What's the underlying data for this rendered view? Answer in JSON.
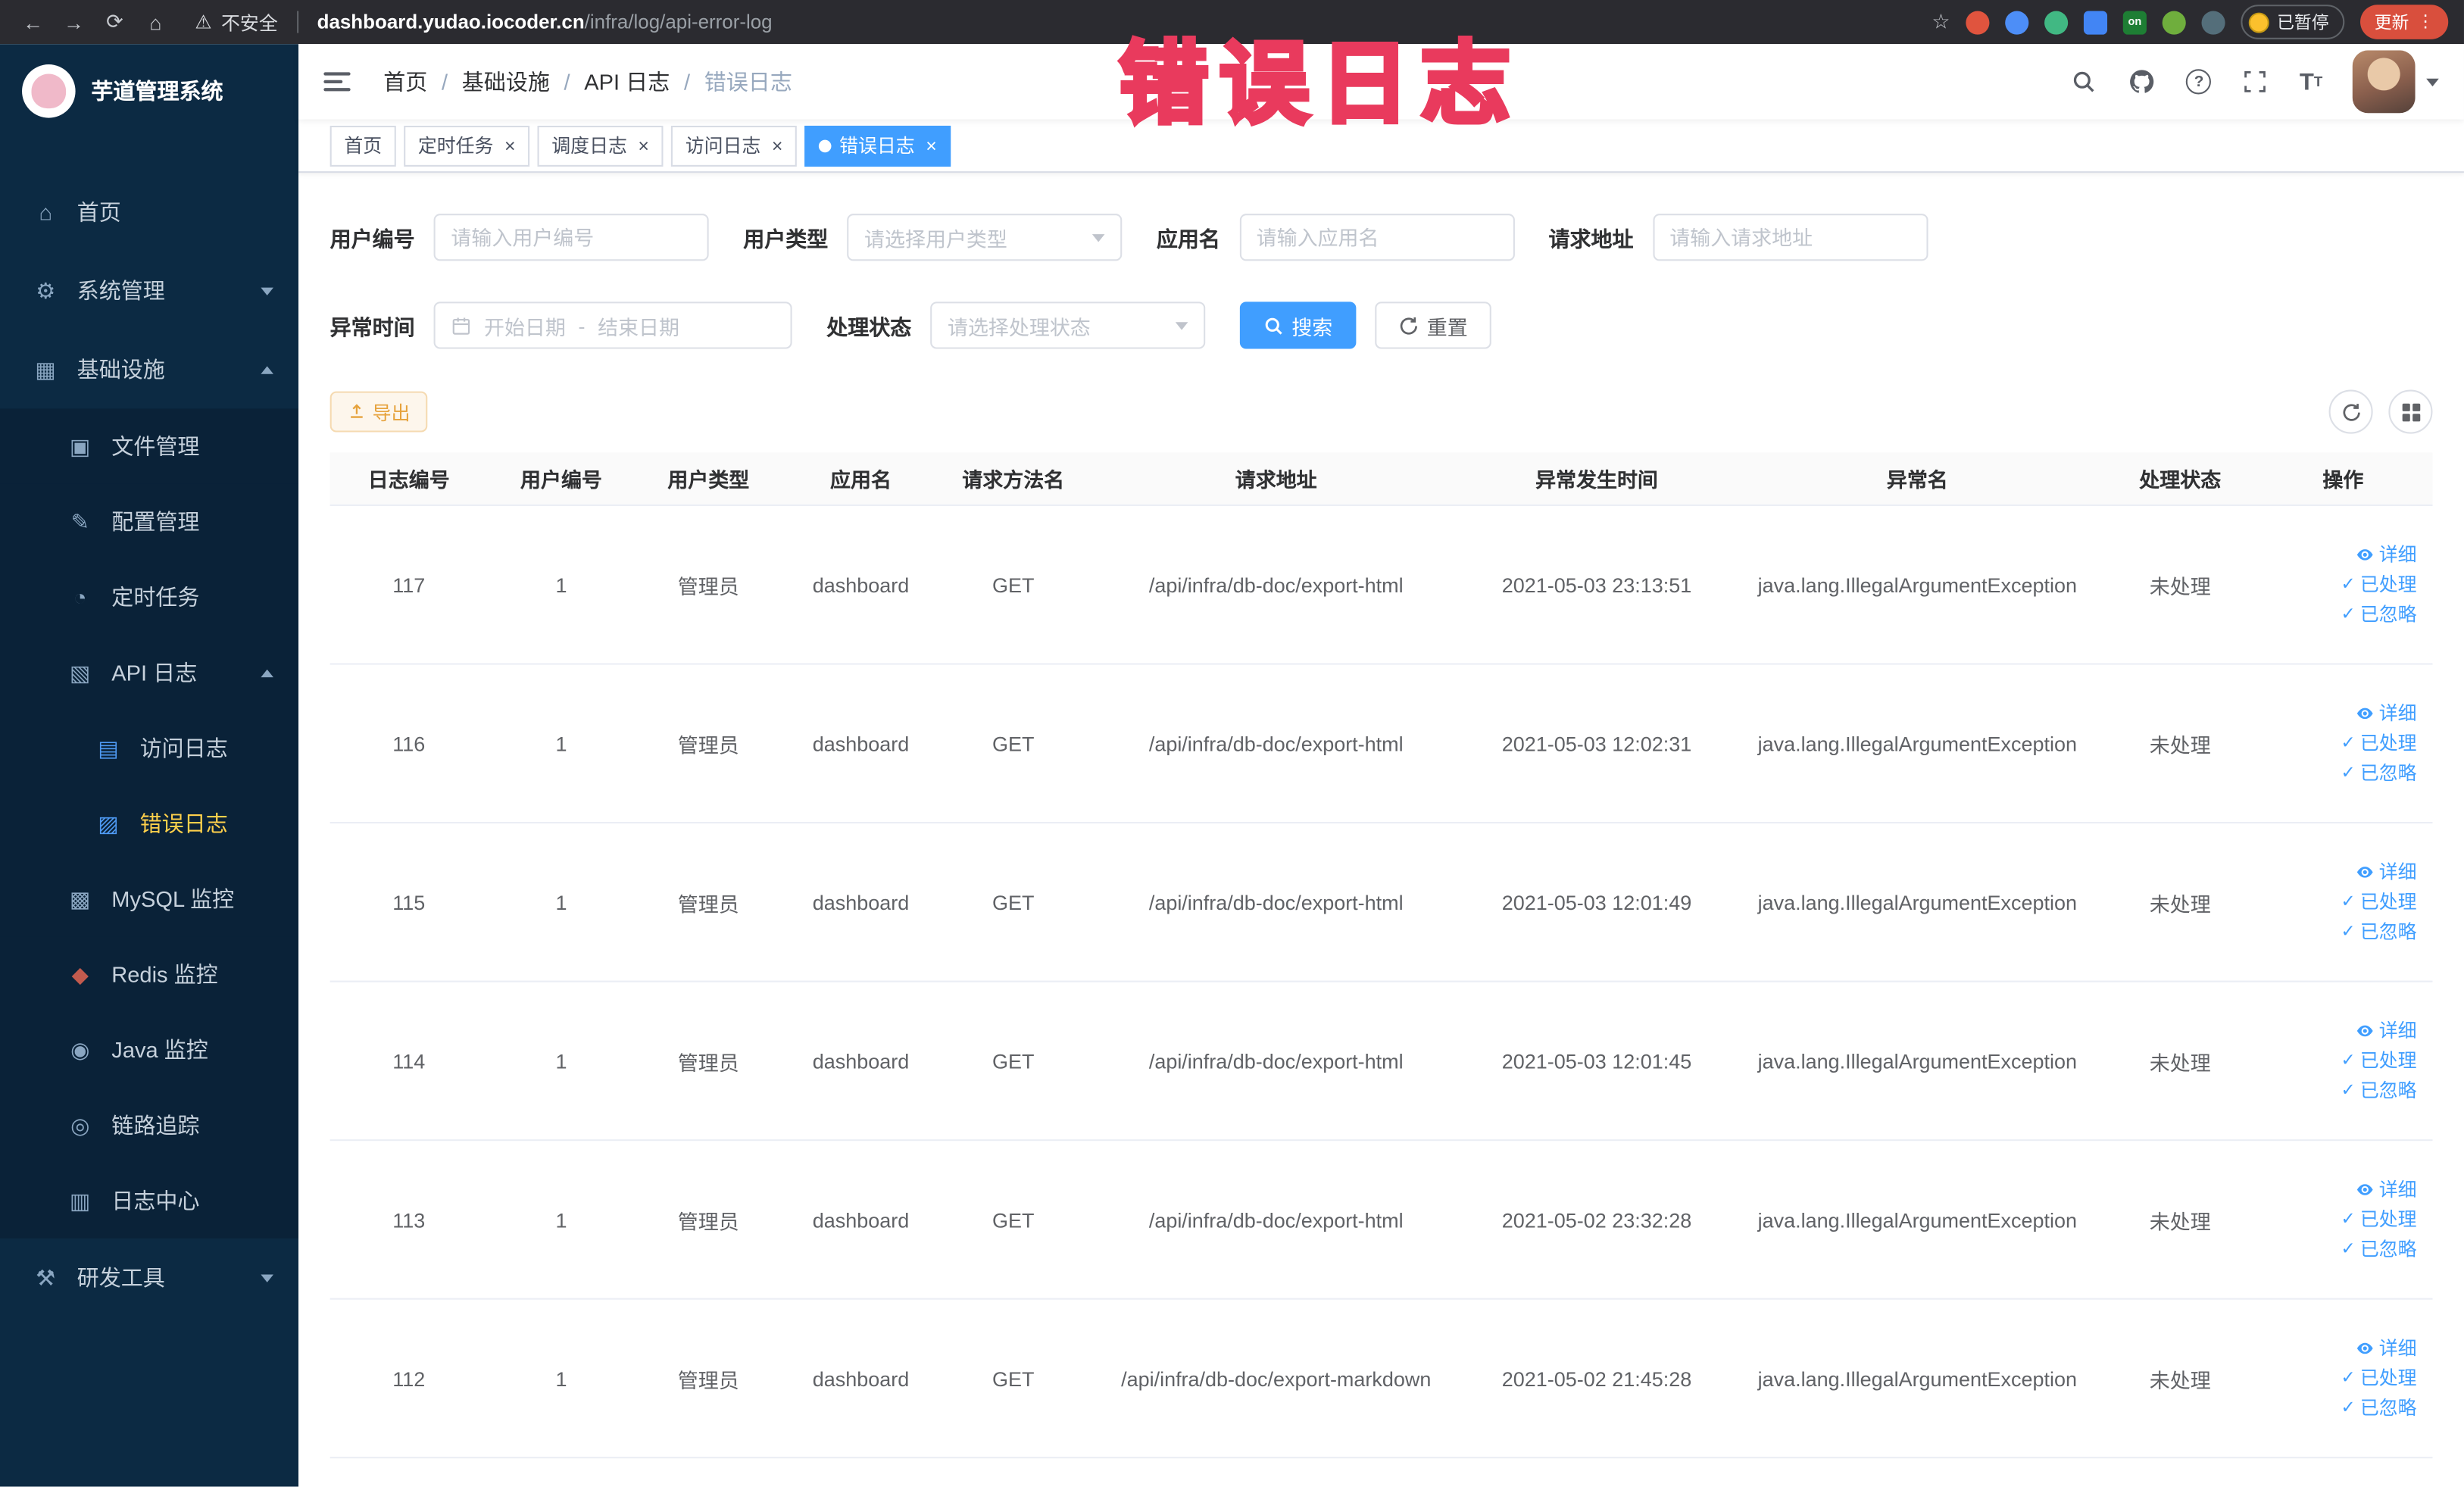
{
  "browser": {
    "security_label": "不安全",
    "url_domain": "dashboard.yudao.iocoder.cn",
    "url_path": "/infra/log/api-error-log",
    "paused_label": "已暂停",
    "update_label": "更新",
    "extensions": [
      {
        "name": "extension-red-circle-icon",
        "color": "#e0543e",
        "shape": "circle"
      },
      {
        "name": "extension-blue-drop-icon",
        "color": "#4d8ef7",
        "shape": "circle"
      },
      {
        "name": "extension-vue-devtools-icon",
        "color": "#41b883",
        "shape": "circle"
      },
      {
        "name": "extension-blue-grid-icon",
        "color": "#4285f4",
        "shape": "square"
      },
      {
        "name": "extension-on-badge-icon",
        "color": "#1e7e34",
        "shape": "square",
        "label": "on"
      },
      {
        "name": "extension-leaf-icon",
        "color": "#6fae3d",
        "shape": "circle"
      },
      {
        "name": "extension-paw-icon",
        "color": "#546e7a",
        "shape": "circle"
      }
    ]
  },
  "annotation": {
    "text": "错误日志"
  },
  "sidebar": {
    "logo_title": "芋道管理系统",
    "items": [
      {
        "label": "首页",
        "icon": "home-icon",
        "level": 1
      },
      {
        "label": "系统管理",
        "icon": "system-icon",
        "level": 1,
        "chevron": "down"
      },
      {
        "label": "基础设施",
        "icon": "infra-icon",
        "level": 1,
        "chevron": "up"
      },
      {
        "label": "文件管理",
        "icon": "file-icon",
        "level": 2
      },
      {
        "label": "配置管理",
        "icon": "config-icon",
        "level": 2
      },
      {
        "label": "定时任务",
        "icon": "job-icon",
        "level": 2
      },
      {
        "label": "API 日志",
        "icon": "api-log-icon",
        "level": 2,
        "chevron": "up"
      },
      {
        "label": "访问日志",
        "icon": "access-log-icon",
        "level": 3,
        "icon_color": "#4f9bf5"
      },
      {
        "label": "错误日志",
        "icon": "error-log-icon",
        "level": 3,
        "icon_color": "#4f9bf5",
        "active": true
      },
      {
        "label": "MySQL 监控",
        "icon": "mysql-icon",
        "level": 2
      },
      {
        "label": "Redis 监控",
        "icon": "redis-icon",
        "level": 2,
        "icon_color": "#c25b4e"
      },
      {
        "label": "Java 监控",
        "icon": "java-icon",
        "level": 2
      },
      {
        "label": "链路追踪",
        "icon": "trace-icon",
        "level": 2
      },
      {
        "label": "日志中心",
        "icon": "log-center-icon",
        "level": 2
      },
      {
        "label": "研发工具",
        "icon": "dev-tools-icon",
        "level": 1,
        "chevron": "down"
      }
    ]
  },
  "header": {
    "breadcrumb": [
      "首页",
      "基础设施",
      "API 日志",
      "错误日志"
    ]
  },
  "tags_view": [
    {
      "label": "首页",
      "closable": false,
      "active": false
    },
    {
      "label": "定时任务",
      "closable": true,
      "active": false
    },
    {
      "label": "调度日志",
      "closable": true,
      "active": false
    },
    {
      "label": "访问日志",
      "closable": true,
      "active": false
    },
    {
      "label": "错误日志",
      "closable": true,
      "active": true
    }
  ],
  "filters": {
    "user_id": {
      "label": "用户编号",
      "placeholder": "请输入用户编号"
    },
    "user_type": {
      "label": "用户类型",
      "placeholder": "请选择用户类型"
    },
    "app_name": {
      "label": "应用名",
      "placeholder": "请输入应用名"
    },
    "request_url": {
      "label": "请求地址",
      "placeholder": "请输入请求地址"
    },
    "exception_time": {
      "label": "异常时间",
      "start_placeholder": "开始日期",
      "separator": "-",
      "end_placeholder": "结束日期"
    },
    "process_status": {
      "label": "处理状态",
      "placeholder": "请选择处理状态"
    },
    "search_label": "搜索",
    "reset_label": "重置"
  },
  "toolbar": {
    "export_label": "导出"
  },
  "table": {
    "columns": [
      {
        "key": "id",
        "label": "日志编号",
        "width": "7.5%"
      },
      {
        "key": "userId",
        "label": "用户编号",
        "width": "7%"
      },
      {
        "key": "userType",
        "label": "用户类型",
        "width": "7%"
      },
      {
        "key": "appName",
        "label": "应用名",
        "width": "7.5%"
      },
      {
        "key": "method",
        "label": "请求方法名",
        "width": "7%"
      },
      {
        "key": "url",
        "label": "请求地址",
        "width": "18%"
      },
      {
        "key": "time",
        "label": "异常发生时间",
        "width": "12.5%"
      },
      {
        "key": "exception",
        "label": "异常名",
        "width": "18%"
      },
      {
        "key": "status",
        "label": "处理状态",
        "width": "7%"
      },
      {
        "key": "actions",
        "label": "操作",
        "width": "8.5%"
      }
    ],
    "action_labels": [
      {
        "key": "detail",
        "label": "详细",
        "icon": "eye-icon"
      },
      {
        "key": "processed",
        "label": "已处理",
        "icon": "check-icon"
      },
      {
        "key": "ignored",
        "label": "已忽略",
        "icon": "check-icon"
      }
    ],
    "rows": [
      {
        "id": "117",
        "userId": "1",
        "userType": "管理员",
        "appName": "dashboard",
        "method": "GET",
        "url": "/api/infra/db-doc/export-html",
        "time": "2021-05-03 23:13:51",
        "exception": "java.lang.IllegalArgumentException",
        "status": "未处理"
      },
      {
        "id": "116",
        "userId": "1",
        "userType": "管理员",
        "appName": "dashboard",
        "method": "GET",
        "url": "/api/infra/db-doc/export-html",
        "time": "2021-05-03 12:02:31",
        "exception": "java.lang.IllegalArgumentException",
        "status": "未处理"
      },
      {
        "id": "115",
        "userId": "1",
        "userType": "管理员",
        "appName": "dashboard",
        "method": "GET",
        "url": "/api/infra/db-doc/export-html",
        "time": "2021-05-03 12:01:49",
        "exception": "java.lang.IllegalArgumentException",
        "status": "未处理"
      },
      {
        "id": "114",
        "userId": "1",
        "userType": "管理员",
        "appName": "dashboard",
        "method": "GET",
        "url": "/api/infra/db-doc/export-html",
        "time": "2021-05-03 12:01:45",
        "exception": "java.lang.IllegalArgumentException",
        "status": "未处理"
      },
      {
        "id": "113",
        "userId": "1",
        "userType": "管理员",
        "appName": "dashboard",
        "method": "GET",
        "url": "/api/infra/db-doc/export-html",
        "time": "2021-05-02 23:32:28",
        "exception": "java.lang.IllegalArgumentException",
        "status": "未处理"
      },
      {
        "id": "112",
        "userId": "1",
        "userType": "管理员",
        "appName": "dashboard",
        "method": "GET",
        "url": "/api/infra/db-doc/export-markdown",
        "time": "2021-05-02 21:45:28",
        "exception": "java.lang.IllegalArgumentException",
        "status": "未处理"
      }
    ]
  }
}
